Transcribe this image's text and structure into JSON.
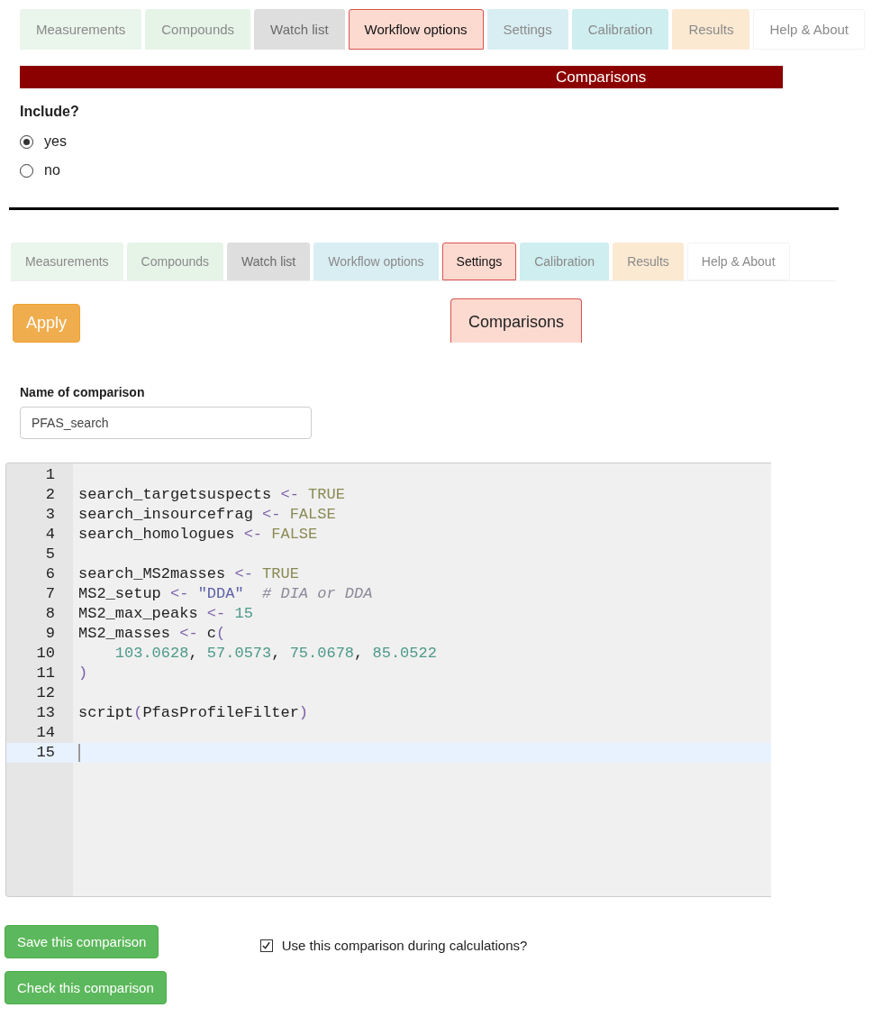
{
  "top_panel": {
    "tabs": [
      {
        "label": "Measurements",
        "selected": false,
        "color": "#eaf5ec"
      },
      {
        "label": "Compounds",
        "selected": false,
        "color": "#e6f4e8"
      },
      {
        "label": "Watch list",
        "selected": false,
        "color": "#dedede"
      },
      {
        "label": "Workflow options",
        "selected": true,
        "color": "#fcdad0"
      },
      {
        "label": "Settings",
        "selected": false,
        "color": "#d9eef3"
      },
      {
        "label": "Calibration",
        "selected": false,
        "color": "#cfeef0"
      },
      {
        "label": "Results",
        "selected": false,
        "color": "#fbe9d2"
      },
      {
        "label": "Help & About",
        "selected": false,
        "color": "#ffffff"
      }
    ],
    "section_header": "Comparisons",
    "include": {
      "label": "Include?",
      "options": [
        {
          "label": "yes",
          "selected": true
        },
        {
          "label": "no",
          "selected": false
        }
      ]
    }
  },
  "bottom_panel": {
    "tabs": [
      {
        "label": "Measurements",
        "selected": false,
        "color": "#eaf5ec"
      },
      {
        "label": "Compounds",
        "selected": false,
        "color": "#e6f4e8"
      },
      {
        "label": "Watch list",
        "selected": false,
        "color": "#dedede"
      },
      {
        "label": "Workflow options",
        "selected": false,
        "color": "#d9eef3"
      },
      {
        "label": "Settings",
        "selected": true,
        "color": "#fcdad0"
      },
      {
        "label": "Calibration",
        "selected": false,
        "color": "#cfeef0"
      },
      {
        "label": "Results",
        "selected": false,
        "color": "#fbe9d2"
      },
      {
        "label": "Help & About",
        "selected": false,
        "color": "#ffffff"
      }
    ],
    "apply_button": "Apply",
    "subtabs": [
      {
        "label": "Comparisons",
        "selected": true
      }
    ],
    "name_field": {
      "label": "Name of comparison",
      "value": "PFAS_search"
    },
    "editor": {
      "lines": [
        {
          "number": "1",
          "current": false
        },
        {
          "number": "2",
          "current": false,
          "tokens": [
            {
              "text": "search_targetsuspects ",
              "kind": "plain"
            },
            {
              "text": "<-",
              "kind": "op"
            },
            {
              "text": " TRUE",
              "kind": "const"
            }
          ]
        },
        {
          "number": "3",
          "current": false,
          "tokens": [
            {
              "text": "search_insourcefrag ",
              "kind": "plain"
            },
            {
              "text": "<-",
              "kind": "op"
            },
            {
              "text": " FALSE",
              "kind": "const"
            }
          ]
        },
        {
          "number": "4",
          "current": false,
          "tokens": [
            {
              "text": "search_homologues ",
              "kind": "plain"
            },
            {
              "text": "<-",
              "kind": "op"
            },
            {
              "text": " FALSE",
              "kind": "const"
            }
          ]
        },
        {
          "number": "5",
          "current": false
        },
        {
          "number": "6",
          "current": false,
          "tokens": [
            {
              "text": "search_MS2masses ",
              "kind": "plain"
            },
            {
              "text": "<-",
              "kind": "op"
            },
            {
              "text": " TRUE",
              "kind": "const"
            }
          ]
        },
        {
          "number": "7",
          "current": false,
          "tokens": [
            {
              "text": "MS2_setup ",
              "kind": "plain"
            },
            {
              "text": "<-",
              "kind": "op"
            },
            {
              "text": " \"DDA\"",
              "kind": "string"
            },
            {
              "text": "  # DIA or DDA",
              "kind": "comment"
            }
          ]
        },
        {
          "number": "8",
          "current": false,
          "tokens": [
            {
              "text": "MS2_max_peaks ",
              "kind": "plain"
            },
            {
              "text": "<-",
              "kind": "op"
            },
            {
              "text": " 15",
              "kind": "number"
            }
          ]
        },
        {
          "number": "9",
          "current": false,
          "tokens": [
            {
              "text": "MS2_masses ",
              "kind": "plain"
            },
            {
              "text": "<-",
              "kind": "op"
            },
            {
              "text": " c",
              "kind": "plain"
            },
            {
              "text": "(",
              "kind": "paren"
            }
          ]
        },
        {
          "number": "10",
          "current": false,
          "tokens": [
            {
              "text": "    103.0628",
              "kind": "number"
            },
            {
              "text": ", ",
              "kind": "plain"
            },
            {
              "text": "57.0573",
              "kind": "number"
            },
            {
              "text": ", ",
              "kind": "plain"
            },
            {
              "text": "75.0678",
              "kind": "number"
            },
            {
              "text": ", ",
              "kind": "plain"
            },
            {
              "text": "85.0522",
              "kind": "number"
            }
          ]
        },
        {
          "number": "11",
          "current": false,
          "tokens": [
            {
              "text": ")",
              "kind": "paren"
            }
          ]
        },
        {
          "number": "12",
          "current": false
        },
        {
          "number": "13",
          "current": false,
          "tokens": [
            {
              "text": "script",
              "kind": "plain"
            },
            {
              "text": "(",
              "kind": "paren"
            },
            {
              "text": "PfasProfileFilter",
              "kind": "plain"
            },
            {
              "text": ")",
              "kind": "paren"
            }
          ]
        },
        {
          "number": "14",
          "current": false
        },
        {
          "number": "15",
          "current": true
        }
      ]
    },
    "buttons": [
      "Save this comparison",
      "Check this comparison"
    ],
    "use_checkbox": {
      "label": "Use this comparison during calculations?",
      "checked": true
    }
  }
}
